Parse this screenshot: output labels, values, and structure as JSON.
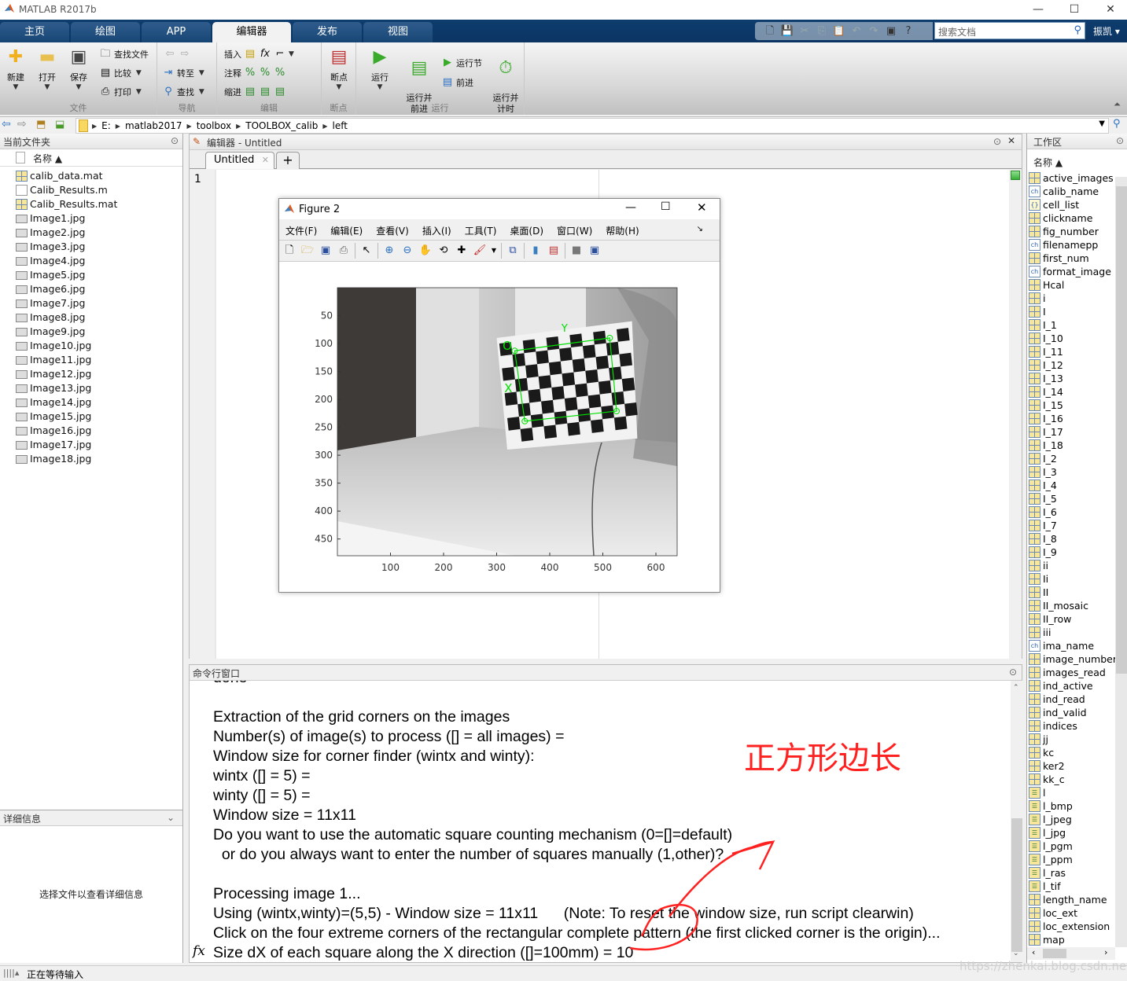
{
  "window": {
    "title": "MATLAB R2017b",
    "minimize": "—",
    "maximize": "☐",
    "close": "✕"
  },
  "ribbon_tabs": [
    {
      "label": "主页"
    },
    {
      "label": "绘图"
    },
    {
      "label": "APP"
    },
    {
      "label": "编辑器",
      "active": true
    },
    {
      "label": "发布"
    },
    {
      "label": "视图"
    }
  ],
  "search": {
    "placeholder": "搜索文档"
  },
  "user": {
    "label": "振凯 ▾"
  },
  "ribbon": {
    "file_group": {
      "label": "文件",
      "new": "新建",
      "open": "打开",
      "save": "保存",
      "find_files": "查找文件",
      "compare": "比较",
      "print": "打印"
    },
    "nav_group": {
      "label": "导航",
      "goto": "转至",
      "find": "查找"
    },
    "edit_group": {
      "label": "编辑",
      "insert": "插入",
      "comment": "注释",
      "indent": "缩进"
    },
    "breakpoint_group": {
      "label": "断点",
      "breakpoints": "断点"
    },
    "run_group": {
      "label": "运行",
      "run": "运行",
      "run_advance": "运行并\n前进",
      "run_section": "运行节",
      "advance": "前进",
      "run_time": "运行并\n计时"
    }
  },
  "address": {
    "crumbs": [
      "E:",
      "matlab2017",
      "toolbox",
      "TOOLBOX_calib",
      "left"
    ]
  },
  "file_panel": {
    "title": "当前文件夹",
    "column": "名称 ▲",
    "files": [
      {
        "name": "calib_data.mat",
        "type": "mat"
      },
      {
        "name": "Calib_Results.m",
        "type": "m"
      },
      {
        "name": "Calib_Results.mat",
        "type": "mat"
      },
      {
        "name": "Image1.jpg",
        "type": "img"
      },
      {
        "name": "Image2.jpg",
        "type": "img"
      },
      {
        "name": "Image3.jpg",
        "type": "img"
      },
      {
        "name": "Image4.jpg",
        "type": "img"
      },
      {
        "name": "Image5.jpg",
        "type": "img"
      },
      {
        "name": "Image6.jpg",
        "type": "img"
      },
      {
        "name": "Image7.jpg",
        "type": "img"
      },
      {
        "name": "Image8.jpg",
        "type": "img"
      },
      {
        "name": "Image9.jpg",
        "type": "img"
      },
      {
        "name": "Image10.jpg",
        "type": "img"
      },
      {
        "name": "Image11.jpg",
        "type": "img"
      },
      {
        "name": "Image12.jpg",
        "type": "img"
      },
      {
        "name": "Image13.jpg",
        "type": "img"
      },
      {
        "name": "Image14.jpg",
        "type": "img"
      },
      {
        "name": "Image15.jpg",
        "type": "img"
      },
      {
        "name": "Image16.jpg",
        "type": "img"
      },
      {
        "name": "Image17.jpg",
        "type": "img"
      },
      {
        "name": "Image18.jpg",
        "type": "img"
      }
    ]
  },
  "detail_panel": {
    "title": "详细信息",
    "empty_text": "选择文件以查看详细信息"
  },
  "editor": {
    "title": "编辑器 - Untitled",
    "tab": "Untitled",
    "line_number": "1"
  },
  "figure": {
    "title": "Figure 2",
    "menu": [
      "文件(F)",
      "编辑(E)",
      "查看(V)",
      "插入(I)",
      "工具(T)",
      "桌面(D)",
      "窗口(W)",
      "帮助(H)"
    ],
    "y_ticks": [
      "50",
      "100",
      "150",
      "200",
      "250",
      "300",
      "350",
      "400",
      "450"
    ],
    "x_ticks": [
      "100",
      "200",
      "300",
      "400",
      "500",
      "600"
    ],
    "labels": {
      "origin": "O",
      "x": "X",
      "y": "Y"
    },
    "accent": "#00e000"
  },
  "command_window": {
    "title": "命令行窗口",
    "lines": [
      "done",
      "",
      "Extraction of the grid corners on the images",
      "Number(s) of image(s) to process ([] = all images) =",
      "Window size for corner finder (wintx and winty):",
      "wintx ([] = 5) =",
      "winty ([] = 5) =",
      "Window size = 11x11",
      "Do you want to use the automatic square counting mechanism (0=[]=default)",
      "  or do you always want to enter the number of squares manually (1,other)?",
      "",
      "Processing image 1...",
      "Using (wintx,winty)=(5,5) - Window size = 11x11      (Note: To reset the window size, run script clearwin)",
      "Click on the four extreme corners of the rectangular complete pattern (the first clicked corner is the origin)...",
      "Size dX of each square along the X direction ([]=100mm) = 10"
    ],
    "prompt_icon": "fx",
    "annotation": "正方形边长",
    "annotation_color": "#ff2020"
  },
  "workspace": {
    "title": "工作区",
    "column": "名称 ▲",
    "vars": [
      {
        "name": "active_images",
        "type": "mat"
      },
      {
        "name": "calib_name",
        "type": "char"
      },
      {
        "name": "cell_list",
        "type": "cell"
      },
      {
        "name": "clickname",
        "type": "mat"
      },
      {
        "name": "fig_number",
        "type": "mat"
      },
      {
        "name": "filenamepp",
        "type": "char"
      },
      {
        "name": "first_num",
        "type": "mat"
      },
      {
        "name": "format_image",
        "type": "char"
      },
      {
        "name": "Hcal",
        "type": "mat"
      },
      {
        "name": "i",
        "type": "mat"
      },
      {
        "name": "I",
        "type": "mat"
      },
      {
        "name": "I_1",
        "type": "mat"
      },
      {
        "name": "I_10",
        "type": "mat"
      },
      {
        "name": "I_11",
        "type": "mat"
      },
      {
        "name": "I_12",
        "type": "mat"
      },
      {
        "name": "I_13",
        "type": "mat"
      },
      {
        "name": "I_14",
        "type": "mat"
      },
      {
        "name": "I_15",
        "type": "mat"
      },
      {
        "name": "I_16",
        "type": "mat"
      },
      {
        "name": "I_17",
        "type": "mat"
      },
      {
        "name": "I_18",
        "type": "mat"
      },
      {
        "name": "I_2",
        "type": "mat"
      },
      {
        "name": "I_3",
        "type": "mat"
      },
      {
        "name": "I_4",
        "type": "mat"
      },
      {
        "name": "I_5",
        "type": "mat"
      },
      {
        "name": "I_6",
        "type": "mat"
      },
      {
        "name": "I_7",
        "type": "mat"
      },
      {
        "name": "I_8",
        "type": "mat"
      },
      {
        "name": "I_9",
        "type": "mat"
      },
      {
        "name": "ii",
        "type": "mat"
      },
      {
        "name": "Ii",
        "type": "mat"
      },
      {
        "name": "II",
        "type": "mat"
      },
      {
        "name": "II_mosaic",
        "type": "mat"
      },
      {
        "name": "II_row",
        "type": "mat"
      },
      {
        "name": "iii",
        "type": "mat"
      },
      {
        "name": "ima_name",
        "type": "char"
      },
      {
        "name": "image_numbers",
        "type": "mat"
      },
      {
        "name": "images_read",
        "type": "mat"
      },
      {
        "name": "ind_active",
        "type": "mat"
      },
      {
        "name": "ind_read",
        "type": "mat"
      },
      {
        "name": "ind_valid",
        "type": "mat"
      },
      {
        "name": "indices",
        "type": "mat"
      },
      {
        "name": "jj",
        "type": "mat"
      },
      {
        "name": "kc",
        "type": "mat"
      },
      {
        "name": "ker2",
        "type": "mat"
      },
      {
        "name": "kk_c",
        "type": "mat"
      },
      {
        "name": "l",
        "type": "logical"
      },
      {
        "name": "l_bmp",
        "type": "logical"
      },
      {
        "name": "l_jpeg",
        "type": "logical"
      },
      {
        "name": "l_jpg",
        "type": "logical"
      },
      {
        "name": "l_pgm",
        "type": "logical"
      },
      {
        "name": "l_ppm",
        "type": "logical"
      },
      {
        "name": "l_ras",
        "type": "logical"
      },
      {
        "name": "l_tif",
        "type": "logical"
      },
      {
        "name": "length_name",
        "type": "mat"
      },
      {
        "name": "loc_ext",
        "type": "mat"
      },
      {
        "name": "loc_extension",
        "type": "mat"
      },
      {
        "name": "map",
        "type": "mat"
      }
    ]
  },
  "status": {
    "text": "正在等待输入"
  },
  "watermark": "https://zhenkai.blog.csdn.net"
}
